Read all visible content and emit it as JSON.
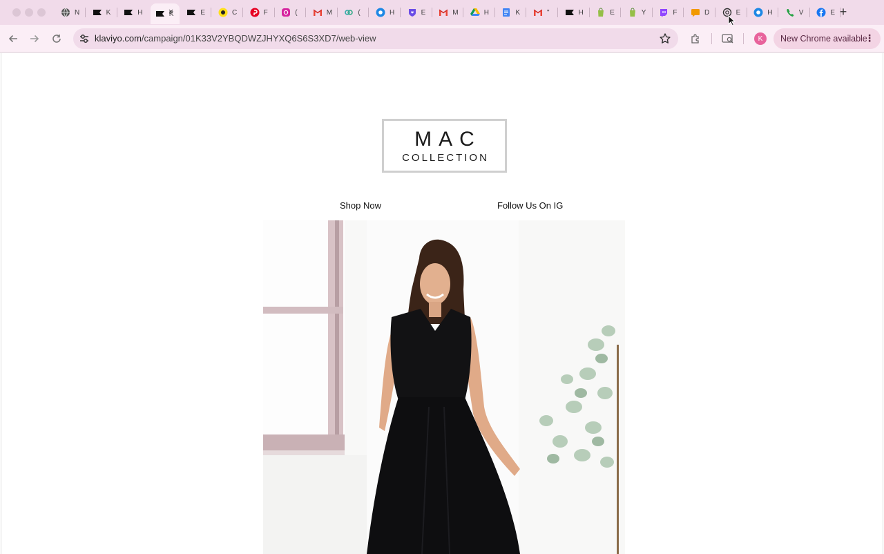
{
  "browser": {
    "tabs": [
      {
        "favicon": "globe-icon",
        "title": "N"
      },
      {
        "favicon": "klaviyo-icon",
        "title": "K"
      },
      {
        "favicon": "klaviyo-icon",
        "title": "H"
      },
      {
        "favicon": "klaviyo-active",
        "title": "K",
        "active": true
      },
      {
        "favicon": "klaviyo-icon",
        "title": "E"
      },
      {
        "favicon": "mailchimp-icon",
        "title": "C"
      },
      {
        "favicon": "pinterest-icon",
        "title": "F"
      },
      {
        "favicon": "instagram-icon",
        "title": "("
      },
      {
        "favicon": "gmail-icon",
        "title": "M"
      },
      {
        "favicon": "link-icon",
        "title": "("
      },
      {
        "favicon": "chrome-blue-icon",
        "title": "H"
      },
      {
        "favicon": "heart-shield-icon",
        "title": "E"
      },
      {
        "favicon": "gmail-icon",
        "title": "M"
      },
      {
        "favicon": "drive-icon",
        "title": "H"
      },
      {
        "favicon": "docs-icon",
        "title": "K"
      },
      {
        "favicon": "gmail-icon",
        "title": "\""
      },
      {
        "favicon": "klaviyo-icon",
        "title": "H"
      },
      {
        "favicon": "shopify-icon",
        "title": "E"
      },
      {
        "favicon": "shopify-icon",
        "title": "Y"
      },
      {
        "favicon": "twitch-icon",
        "title": "F"
      },
      {
        "favicon": "chat-icon",
        "title": "D"
      },
      {
        "favicon": "openai-icon",
        "title": "E"
      },
      {
        "favicon": "chrome-blue-icon",
        "title": "H"
      },
      {
        "favicon": "phone-icon",
        "title": "V"
      },
      {
        "favicon": "facebook-icon",
        "title": "E"
      }
    ],
    "new_tab_label": "+",
    "close_tab_label": "×",
    "url_domain": "klaviyo.com",
    "url_path": "/campaign/01K33V2YBQDWZJHYXQ6S6S3XD7/web-view",
    "profile_initial": "K",
    "update_chip_label": "New Chrome available",
    "menu_dots": "⋮"
  },
  "email": {
    "logo_line1": "MAC",
    "logo_line2": "COLLECTION",
    "nav": {
      "shop_now": "Shop Now",
      "follow_ig": "Follow Us On IG"
    },
    "hero_alt": "Woman in black sleeveless midi dress"
  },
  "colors": {
    "tabstrip_bg": "#f1dbea",
    "toolbar_bg": "#fbeef6",
    "accent_pink": "#e8639c",
    "dress": "#121214"
  }
}
